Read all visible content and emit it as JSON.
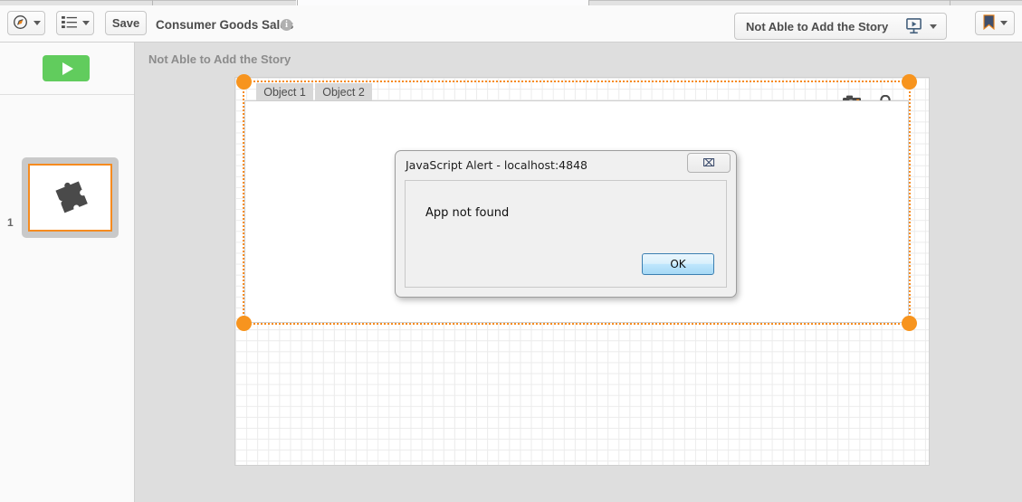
{
  "browser": {
    "tab_seam_positions": [
      168,
      328,
      490,
      650,
      1049
    ]
  },
  "toolbar": {
    "nav_button": {
      "icon": "compass-icon",
      "caret": true
    },
    "sheets_button": {
      "icon": "list-icon",
      "caret": true
    },
    "save_label": "Save",
    "doc_title": "Consumer Goods Sales",
    "info_icon_glyph": "i",
    "story_select_label": "Not Able to Add the Story",
    "present_icon": "presentation-monitor-icon",
    "bookmark_icon": "bookmark-icon"
  },
  "left_panel": {
    "play_button_label": "play-story",
    "slide_number": "1",
    "thumbnail_icon": "puzzle-piece-icon"
  },
  "workspace": {
    "story_heading": "Not Able to Add the Story",
    "object": {
      "tabs": [
        {
          "label": "Object 1",
          "active": false
        },
        {
          "label": "Object 2",
          "active": false
        }
      ],
      "snapshot_icon": "camera-icon",
      "lock_icon": "lock-icon",
      "handle_color": "#f7941e",
      "selection_border_color": "#f68b1f"
    }
  },
  "alert_dialog": {
    "title": "JavaScript Alert - localhost:4848",
    "close_glyph": "⌧",
    "message": "App not found",
    "ok_label": "OK"
  },
  "colors": {
    "accent_orange": "#f7941e",
    "play_green": "#61cc5d",
    "workspace_gray": "#dedede",
    "toolbar_gray": "#fafafa"
  }
}
